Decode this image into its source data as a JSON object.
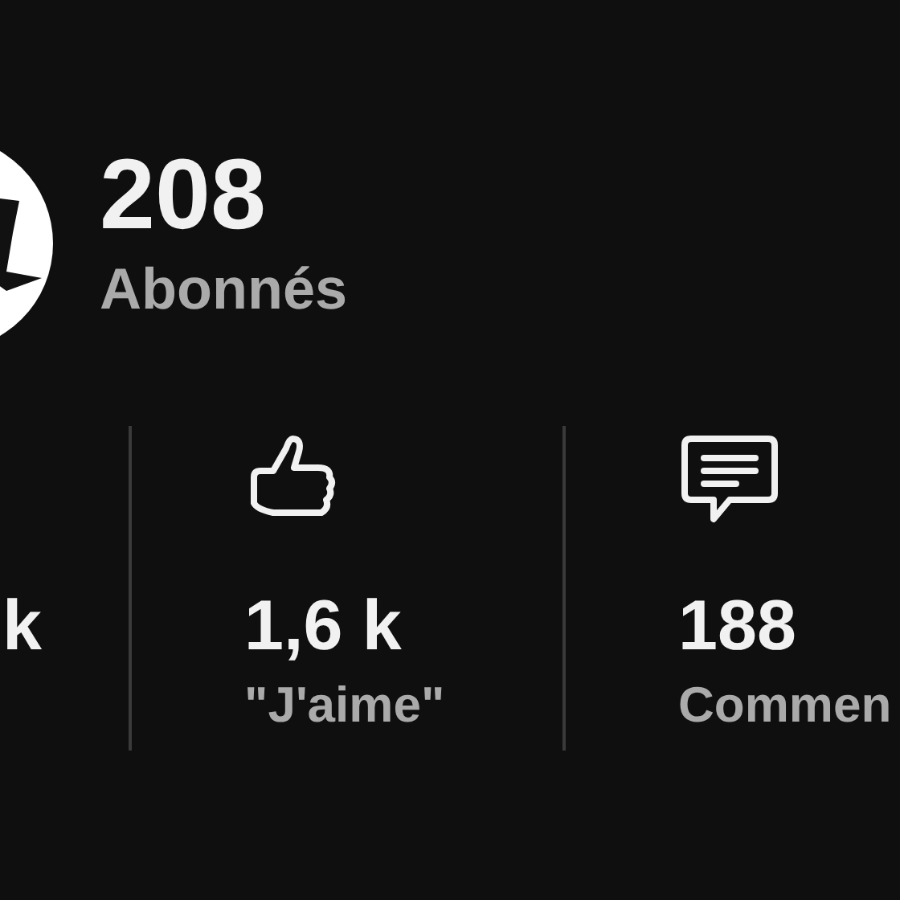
{
  "profile": {
    "count": "208",
    "label": "Abonnés"
  },
  "stats": [
    {
      "kind": "partial",
      "value": "k"
    },
    {
      "kind": "likes",
      "value": "1,6 k",
      "label": "\"J'aime\""
    },
    {
      "kind": "comments",
      "value": "188",
      "label": "Commen"
    }
  ]
}
